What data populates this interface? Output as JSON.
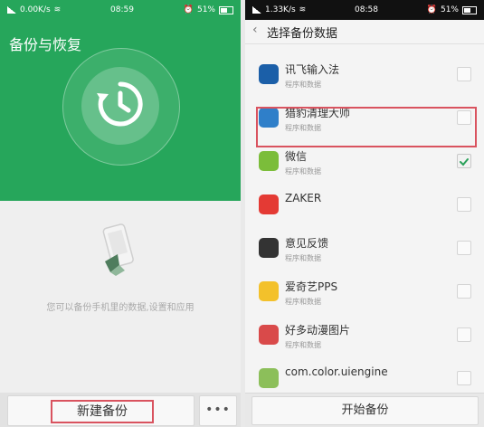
{
  "left": {
    "status": {
      "speed": "0.00K/s",
      "time": "08:59",
      "battery": "51%"
    },
    "title": "备份与恢复",
    "hint": "您可以备份手机里的数据,设置和应用",
    "new_backup_label": "新建备份",
    "more_label": "•••"
  },
  "right": {
    "status": {
      "speed": "1.33K/s",
      "time": "08:58",
      "battery": "51%"
    },
    "back": "‹",
    "title": "选择备份数据",
    "items": [
      {
        "name": "讯飞输入法",
        "sub": "程序和数据",
        "checked": false,
        "icon": "iflytek-icon",
        "color": "#1b5fa8"
      },
      {
        "name": "猎豹清理大师",
        "sub": "程序和数据",
        "checked": false,
        "icon": "cheetah-cleaner-icon",
        "color": "#2f7fc9"
      },
      {
        "name": "微信",
        "sub": "程序和数据",
        "checked": true,
        "icon": "wechat-icon",
        "color": "#7bbd3a"
      },
      {
        "name": "ZAKER",
        "sub": "",
        "checked": false,
        "icon": "zaker-icon",
        "color": "#e43a34"
      },
      {
        "name": "意见反馈",
        "sub": "程序和数据",
        "checked": false,
        "icon": "feedback-headset-icon",
        "color": "#333333"
      },
      {
        "name": "爱奇艺PPS",
        "sub": "程序和数据",
        "checked": false,
        "icon": "iqiyi-pps-icon",
        "color": "#f3c12b"
      },
      {
        "name": "好多动漫图片",
        "sub": "程序和数据",
        "checked": false,
        "icon": "anime-pictures-icon",
        "color": "#d94a4a"
      },
      {
        "name": "com.color.uiengine",
        "sub": "",
        "checked": false,
        "icon": "uiengine-icon",
        "color": "#8cbf5a"
      }
    ],
    "start_label": "开始备份"
  },
  "colors": {
    "primary_green": "#26a65b",
    "highlight_red": "#d9535f",
    "check_green": "#2aa15a"
  }
}
